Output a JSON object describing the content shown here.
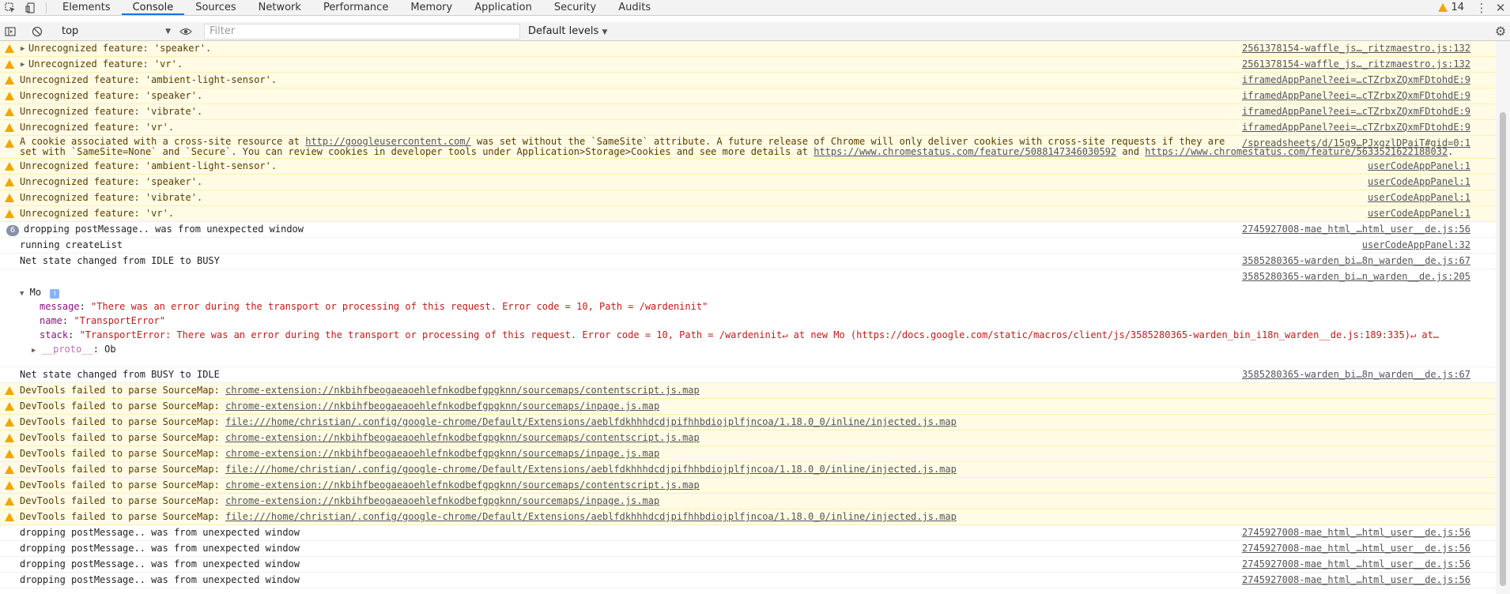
{
  "tabbar": {
    "tabs": [
      "Elements",
      "Console",
      "Sources",
      "Network",
      "Performance",
      "Memory",
      "Application",
      "Security",
      "Audits"
    ],
    "active_tab": "Console",
    "warning_count": "14"
  },
  "toolbar": {
    "context": "top",
    "filter_placeholder": "Filter",
    "levels": "Default levels"
  },
  "console": {
    "rows": [
      {
        "type": "warn",
        "expandable": true,
        "msg": "Unrecognized feature: 'speaker'.",
        "src": "2561378154-waffle_js…_ritzmaestro.js:132"
      },
      {
        "type": "warn",
        "expandable": true,
        "msg": "Unrecognized feature: 'vr'.",
        "src": "2561378154-waffle_js…_ritzmaestro.js:132"
      },
      {
        "type": "warn",
        "msg": "Unrecognized feature: 'ambient-light-sensor'.",
        "src": "iframedAppPanel?eei=…cTZrbxZQxmFDtohdE:9"
      },
      {
        "type": "warn",
        "msg": "Unrecognized feature: 'speaker'.",
        "src": "iframedAppPanel?eei=…cTZrbxZQxmFDtohdE:9"
      },
      {
        "type": "warn",
        "msg": "Unrecognized feature: 'vibrate'.",
        "src": "iframedAppPanel?eei=…cTZrbxZQxmFDtohdE:9"
      },
      {
        "type": "warn",
        "msg": "Unrecognized feature: 'vr'.",
        "src": "iframedAppPanel?eei=…cTZrbxZQxmFDtohdE:9"
      }
    ],
    "cookie": {
      "line1_a": "A cookie associated with a cross-site resource at ",
      "line1_link": "http://googleusercontent.com/",
      "line1_b": " was set without the `SameSite` attribute. A future release of Chrome will only deliver cookies with cross-site requests if they are",
      "line2_a": "set with `SameSite=None` and `Secure`. You can review cookies in developer tools under Application>Storage>Cookies and see more details at ",
      "line2_link1": "https://www.chromestatus.com/feature/5088147346030592",
      "line2_b": " and ",
      "line2_link2": "https://www.chromestatus.com/feature/5633521622188032",
      "line2_c": ".",
      "src": "/spreadsheets/d/15g9…PJxgzlDPaiT#gid=0:1"
    },
    "rows2": [
      {
        "type": "warn",
        "msg": "Unrecognized feature: 'ambient-light-sensor'.",
        "src": "userCodeAppPanel:1"
      },
      {
        "type": "warn",
        "msg": "Unrecognized feature: 'speaker'.",
        "src": "userCodeAppPanel:1"
      },
      {
        "type": "warn",
        "msg": "Unrecognized feature: 'vibrate'.",
        "src": "userCodeAppPanel:1"
      },
      {
        "type": "warn",
        "msg": "Unrecognized feature: 'vr'.",
        "src": "userCodeAppPanel:1"
      },
      {
        "type": "log",
        "count": "6",
        "msg": "dropping postMessage.. was from unexpected window",
        "src": "2745927008-mae_html_…html_user__de.js:56"
      },
      {
        "type": "log",
        "msg": "running createList",
        "src": "userCodeAppPanel:32"
      },
      {
        "type": "log",
        "msg": "Net state changed from IDLE to BUSY",
        "src": "3585280365-warden_bi…8n_warden__de.js:67"
      }
    ],
    "error_object": {
      "src": "3585280365-warden_bi…n_warden__de.js:205",
      "name": "Mo",
      "info": "i",
      "message_key": "message",
      "message_val": "\"There was an error during the transport or processing of this request. Error code = 10, Path = /wardeninit\"",
      "name_key": "name",
      "name_val": "\"TransportError\"",
      "stack_key": "stack",
      "stack_val": "\"TransportError: There was an error during the transport or processing of this request. Error code = 10, Path = /wardeninit↵    at new Mo (https://docs.google.com/static/macros/client/js/3585280365-warden_bin_i18n_warden__de.js:189:335)↵    at…",
      "proto_key": "__proto__",
      "proto_val": "Ob"
    },
    "rows3": [
      {
        "type": "log",
        "msg": "Net state changed from BUSY to IDLE",
        "src": "3585280365-warden_bi…8n_warden__de.js:67"
      },
      {
        "type": "warn",
        "prefix": "DevTools failed to parse SourceMap: ",
        "url": "chrome-extension://nkbihfbeogaeaoehlefnkodbefgpgknn/sourcemaps/contentscript.js.map"
      },
      {
        "type": "warn",
        "prefix": "DevTools failed to parse SourceMap: ",
        "url": "chrome-extension://nkbihfbeogaeaoehlefnkodbefgpgknn/sourcemaps/inpage.js.map"
      },
      {
        "type": "warn",
        "prefix": "DevTools failed to parse SourceMap: ",
        "url": "file:///home/christian/.config/google-chrome/Default/Extensions/aeblfdkhhhdcdjpifhhbdiojplfjncoa/1.18.0_0/inline/injected.js.map"
      },
      {
        "type": "warn",
        "prefix": "DevTools failed to parse SourceMap: ",
        "url": "chrome-extension://nkbihfbeogaeaoehlefnkodbefgpgknn/sourcemaps/contentscript.js.map"
      },
      {
        "type": "warn",
        "prefix": "DevTools failed to parse SourceMap: ",
        "url": "chrome-extension://nkbihfbeogaeaoehlefnkodbefgpgknn/sourcemaps/inpage.js.map"
      },
      {
        "type": "warn",
        "prefix": "DevTools failed to parse SourceMap: ",
        "url": "file:///home/christian/.config/google-chrome/Default/Extensions/aeblfdkhhhdcdjpifhhbdiojplfjncoa/1.18.0_0/inline/injected.js.map"
      },
      {
        "type": "warn",
        "prefix": "DevTools failed to parse SourceMap: ",
        "url": "chrome-extension://nkbihfbeogaeaoehlefnkodbefgpgknn/sourcemaps/contentscript.js.map"
      },
      {
        "type": "warn",
        "prefix": "DevTools failed to parse SourceMap: ",
        "url": "chrome-extension://nkbihfbeogaeaoehlefnkodbefgpgknn/sourcemaps/inpage.js.map"
      },
      {
        "type": "warn",
        "prefix": "DevTools failed to parse SourceMap: ",
        "url": "file:///home/christian/.config/google-chrome/Default/Extensions/aeblfdkhhhdcdjpifhhbdiojplfjncoa/1.18.0_0/inline/injected.js.map"
      },
      {
        "type": "log",
        "msg": "dropping postMessage.. was from unexpected window",
        "src": "2745927008-mae_html_…html_user__de.js:56"
      },
      {
        "type": "log",
        "msg": "dropping postMessage.. was from unexpected window",
        "src": "2745927008-mae_html_…html_user__de.js:56"
      },
      {
        "type": "log",
        "msg": "dropping postMessage.. was from unexpected window",
        "src": "2745927008-mae_html_…html_user__de.js:56"
      },
      {
        "type": "log",
        "msg": "dropping postMessage.. was from unexpected window",
        "src": "2745927008-mae_html_…html_user__de.js:56"
      }
    ]
  }
}
